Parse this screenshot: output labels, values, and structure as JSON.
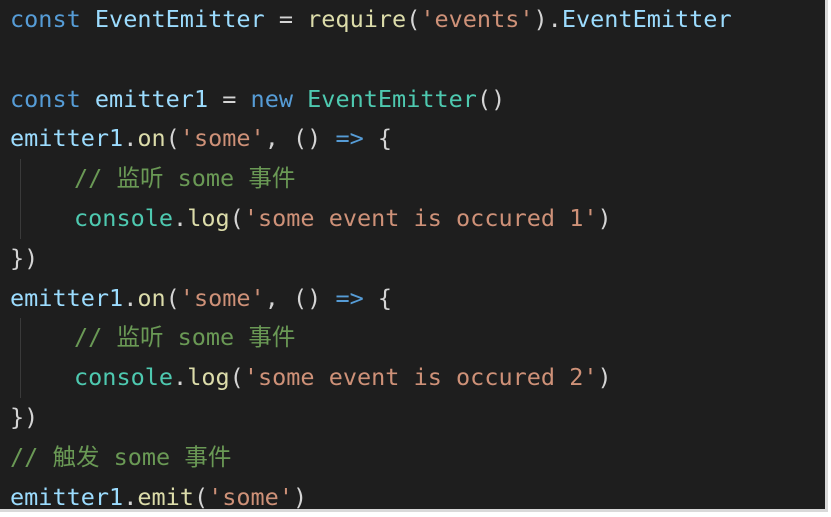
{
  "editor": {
    "lines": [
      {
        "tokens": [
          {
            "t": "const",
            "c": "kw"
          },
          {
            "t": " ",
            "c": "punc"
          },
          {
            "t": "EventEmitter",
            "c": "var"
          },
          {
            "t": " = ",
            "c": "punc"
          },
          {
            "t": "require",
            "c": "fn"
          },
          {
            "t": "(",
            "c": "punc"
          },
          {
            "t": "'events'",
            "c": "str"
          },
          {
            "t": ").",
            "c": "punc"
          },
          {
            "t": "EventEmitter",
            "c": "var"
          }
        ]
      },
      {
        "tokens": []
      },
      {
        "tokens": [
          {
            "t": "const",
            "c": "kw"
          },
          {
            "t": " ",
            "c": "punc"
          },
          {
            "t": "emitter1",
            "c": "var"
          },
          {
            "t": " = ",
            "c": "punc"
          },
          {
            "t": "new",
            "c": "kw"
          },
          {
            "t": " ",
            "c": "punc"
          },
          {
            "t": "EventEmitter",
            "c": "cls"
          },
          {
            "t": "()",
            "c": "punc"
          }
        ]
      },
      {
        "tokens": [
          {
            "t": "emitter1",
            "c": "var"
          },
          {
            "t": ".",
            "c": "punc"
          },
          {
            "t": "on",
            "c": "fn"
          },
          {
            "t": "(",
            "c": "punc"
          },
          {
            "t": "'some'",
            "c": "str"
          },
          {
            "t": ", () ",
            "c": "punc"
          },
          {
            "t": "=>",
            "c": "kw"
          },
          {
            "t": " {",
            "c": "punc"
          }
        ]
      },
      {
        "indent": true,
        "tokens": [
          {
            "t": "// 监听 some 事件",
            "c": "cm"
          }
        ]
      },
      {
        "indent": true,
        "tokens": [
          {
            "t": "console",
            "c": "cls"
          },
          {
            "t": ".",
            "c": "punc"
          },
          {
            "t": "log",
            "c": "fn"
          },
          {
            "t": "(",
            "c": "punc"
          },
          {
            "t": "'some event is occured 1'",
            "c": "str"
          },
          {
            "t": ")",
            "c": "punc"
          }
        ]
      },
      {
        "tokens": [
          {
            "t": "})",
            "c": "punc"
          }
        ]
      },
      {
        "tokens": [
          {
            "t": "emitter1",
            "c": "var"
          },
          {
            "t": ".",
            "c": "punc"
          },
          {
            "t": "on",
            "c": "fn"
          },
          {
            "t": "(",
            "c": "punc"
          },
          {
            "t": "'some'",
            "c": "str"
          },
          {
            "t": ", () ",
            "c": "punc"
          },
          {
            "t": "=>",
            "c": "kw"
          },
          {
            "t": " {",
            "c": "punc"
          }
        ]
      },
      {
        "indent": true,
        "tokens": [
          {
            "t": "// 监听 some 事件",
            "c": "cm"
          }
        ]
      },
      {
        "indent": true,
        "tokens": [
          {
            "t": "console",
            "c": "cls"
          },
          {
            "t": ".",
            "c": "punc"
          },
          {
            "t": "log",
            "c": "fn"
          },
          {
            "t": "(",
            "c": "punc"
          },
          {
            "t": "'some event is occured 2'",
            "c": "str"
          },
          {
            "t": ")",
            "c": "punc"
          }
        ]
      },
      {
        "tokens": [
          {
            "t": "})",
            "c": "punc"
          }
        ]
      },
      {
        "tokens": [
          {
            "t": "// 触发 some 事件",
            "c": "cm"
          }
        ]
      },
      {
        "tokens": [
          {
            "t": "emitter1",
            "c": "var"
          },
          {
            "t": ".",
            "c": "punc"
          },
          {
            "t": "emit",
            "c": "fn"
          },
          {
            "t": "(",
            "c": "punc"
          },
          {
            "t": "'some'",
            "c": "str"
          },
          {
            "t": ")",
            "c": "punc"
          }
        ]
      }
    ]
  },
  "colors": {
    "background": "#1e1e1e",
    "keyword": "#569cd6",
    "variable": "#9cdcfe",
    "function": "#dcdcaa",
    "class": "#4ec9b0",
    "string": "#ce9178",
    "comment": "#6a9955",
    "punctuation": "#d4d4d4"
  }
}
